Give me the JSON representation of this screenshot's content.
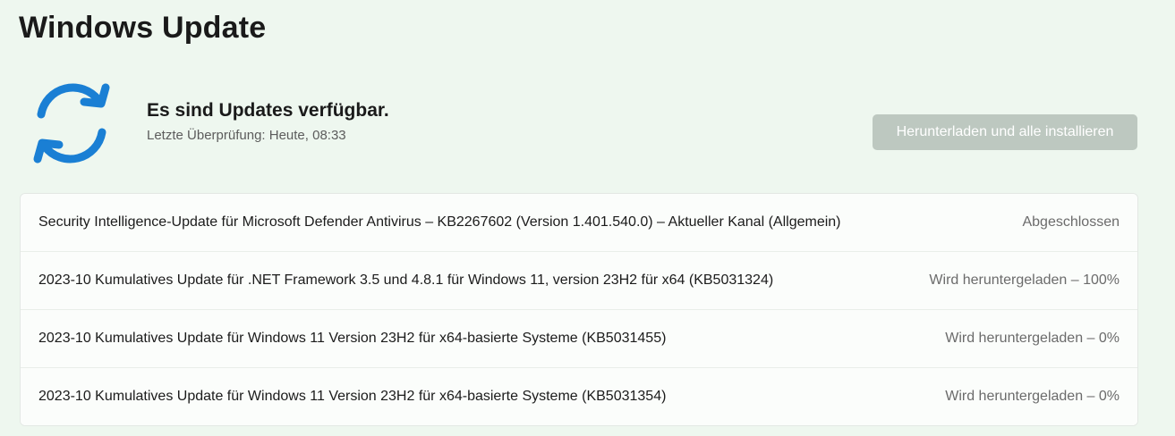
{
  "page": {
    "title": "Windows Update"
  },
  "status": {
    "heading": "Es sind Updates verfügbar.",
    "last_check": "Letzte Überprüfung: Heute, 08:33",
    "icon": "sync-icon",
    "icon_color": "#1a7fd4"
  },
  "actions": {
    "download_install_label": "Herunterladen und alle installieren"
  },
  "updates": [
    {
      "name": "Security Intelligence-Update für Microsoft Defender Antivirus – KB2267602 (Version 1.401.540.0) – Aktueller Kanal (Allgemein)",
      "status": "Abgeschlossen"
    },
    {
      "name": "2023-10 Kumulatives Update für .NET Framework 3.5 und 4.8.1 für Windows 11, version 23H2 für x64 (KB5031324)",
      "status": "Wird heruntergeladen – 100%"
    },
    {
      "name": "2023-10 Kumulatives Update für Windows 11 Version 23H2 für x64-basierte Systeme (KB5031455)",
      "status": "Wird heruntergeladen – 0%"
    },
    {
      "name": "2023-10 Kumulatives Update für Windows 11 Version 23H2 für x64-basierte Systeme (KB5031354)",
      "status": "Wird heruntergeladen – 0%"
    }
  ]
}
